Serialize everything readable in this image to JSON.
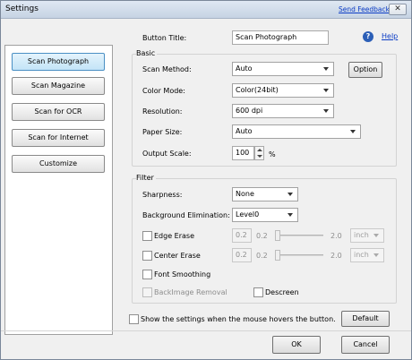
{
  "window": {
    "title": "Settings",
    "send_feedback": "Send Feedback",
    "close_glyph": "✕"
  },
  "sidebar": {
    "items": [
      {
        "label": "Scan Photograph",
        "selected": true
      },
      {
        "label": "Scan Magazine"
      },
      {
        "label": "Scan for OCR"
      },
      {
        "label": "Scan for Internet"
      },
      {
        "label": "Customize"
      }
    ]
  },
  "header": {
    "button_title_label": "Button Title:",
    "button_title_value": "Scan Photograph",
    "help_glyph": "?",
    "help_link": "Help"
  },
  "basic": {
    "group_label": "Basic",
    "scan_method_label": "Scan Method:",
    "scan_method_value": "Auto",
    "option_button": "Option",
    "color_mode_label": "Color Mode:",
    "color_mode_value": "Color(24bit)",
    "resolution_label": "Resolution:",
    "resolution_value": "600 dpi",
    "paper_size_label": "Paper Size:",
    "paper_size_value": "Auto",
    "output_scale_label": "Output Scale:",
    "output_scale_value": "100",
    "output_scale_unit": "%"
  },
  "filter": {
    "group_label": "Filter",
    "sharpness_label": "Sharpness:",
    "sharpness_value": "None",
    "background_elim_label": "Background Elimination:",
    "background_elim_value": "Level0",
    "edge_erase_label": "Edge Erase",
    "edge_erase_value": "0.2",
    "edge_erase_min": "0.2",
    "edge_erase_max": "2.0",
    "edge_erase_unit": "inch",
    "center_erase_label": "Center Erase",
    "center_erase_value": "0.2",
    "center_erase_min": "0.2",
    "center_erase_max": "2.0",
    "center_erase_unit": "inch",
    "font_smoothing_label": "Font Smoothing",
    "backimage_removal_label": "BackImage Removal",
    "descreen_label": "Descreen"
  },
  "footer": {
    "hover_label": "Show the settings when the mouse hovers the button.",
    "default_button": "Default",
    "ok_button": "OK",
    "cancel_button": "Cancel"
  }
}
